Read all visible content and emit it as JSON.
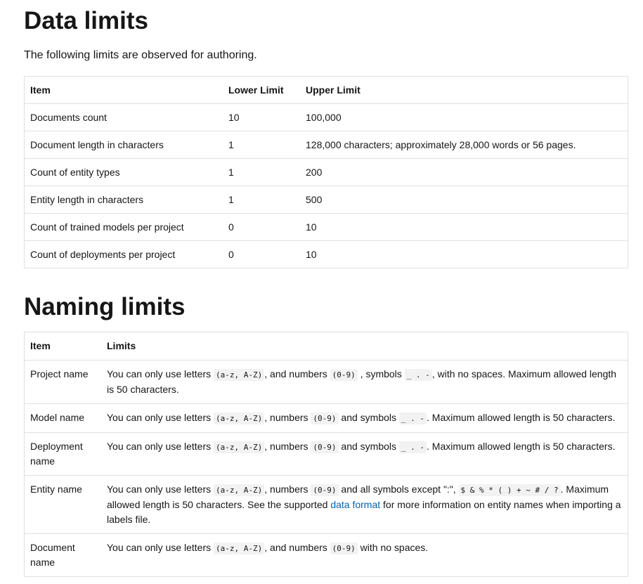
{
  "data_limits": {
    "heading": "Data limits",
    "intro": "The following limits are observed for authoring.",
    "headers": [
      "Item",
      "Lower Limit",
      "Upper Limit"
    ],
    "rows": [
      [
        "Documents count",
        "10",
        "100,000"
      ],
      [
        "Document length in characters",
        "1",
        "128,000 characters; approximately 28,000 words or 56 pages."
      ],
      [
        "Count of entity types",
        "1",
        "200"
      ],
      [
        "Entity length in characters",
        "1",
        "500"
      ],
      [
        "Count of trained models per project",
        "0",
        "10"
      ],
      [
        "Count of deployments per project",
        "0",
        "10"
      ]
    ]
  },
  "naming_limits": {
    "heading": "Naming limits",
    "headers": [
      "Item",
      "Limits"
    ],
    "rows": [
      {
        "item": "Project name",
        "parts": [
          {
            "t": "text",
            "v": "You can only use letters "
          },
          {
            "t": "code",
            "v": "(a-z, A-Z)"
          },
          {
            "t": "text",
            "v": ", and numbers "
          },
          {
            "t": "code",
            "v": "(0-9)"
          },
          {
            "t": "text",
            "v": " , symbols "
          },
          {
            "t": "code",
            "v": "_ . -"
          },
          {
            "t": "text",
            "v": ", with no spaces. Maximum allowed length is 50 characters."
          }
        ]
      },
      {
        "item": "Model name",
        "parts": [
          {
            "t": "text",
            "v": "You can only use letters "
          },
          {
            "t": "code",
            "v": "(a-z, A-Z)"
          },
          {
            "t": "text",
            "v": ", numbers "
          },
          {
            "t": "code",
            "v": "(0-9)"
          },
          {
            "t": "text",
            "v": " and symbols "
          },
          {
            "t": "code",
            "v": "_ . -"
          },
          {
            "t": "text",
            "v": ". Maximum allowed length is 50 characters."
          }
        ]
      },
      {
        "item": "Deployment name",
        "parts": [
          {
            "t": "text",
            "v": "You can only use letters "
          },
          {
            "t": "code",
            "v": "(a-z, A-Z)"
          },
          {
            "t": "text",
            "v": ", numbers "
          },
          {
            "t": "code",
            "v": "(0-9)"
          },
          {
            "t": "text",
            "v": " and symbols "
          },
          {
            "t": "code",
            "v": "_ . -"
          },
          {
            "t": "text",
            "v": ". Maximum allowed length is 50 characters."
          }
        ]
      },
      {
        "item": "Entity name",
        "parts": [
          {
            "t": "text",
            "v": "You can only use letters "
          },
          {
            "t": "code",
            "v": "(a-z, A-Z)"
          },
          {
            "t": "text",
            "v": ", numbers "
          },
          {
            "t": "code",
            "v": "(0-9)"
          },
          {
            "t": "text",
            "v": " and all symbols except \":\", "
          },
          {
            "t": "code",
            "v": "$ & % * ( ) + ~ # / ?"
          },
          {
            "t": "text",
            "v": ". Maximum allowed length is 50 characters. See the supported "
          },
          {
            "t": "link",
            "v": "data format"
          },
          {
            "t": "text",
            "v": " for more information on entity names when importing a labels file."
          }
        ]
      },
      {
        "item": "Document name",
        "parts": [
          {
            "t": "text",
            "v": "You can only use letters "
          },
          {
            "t": "code",
            "v": "(a-z, A-Z)"
          },
          {
            "t": "text",
            "v": ", and numbers "
          },
          {
            "t": "code",
            "v": "(0-9)"
          },
          {
            "t": "text",
            "v": " with no spaces."
          }
        ]
      }
    ]
  }
}
